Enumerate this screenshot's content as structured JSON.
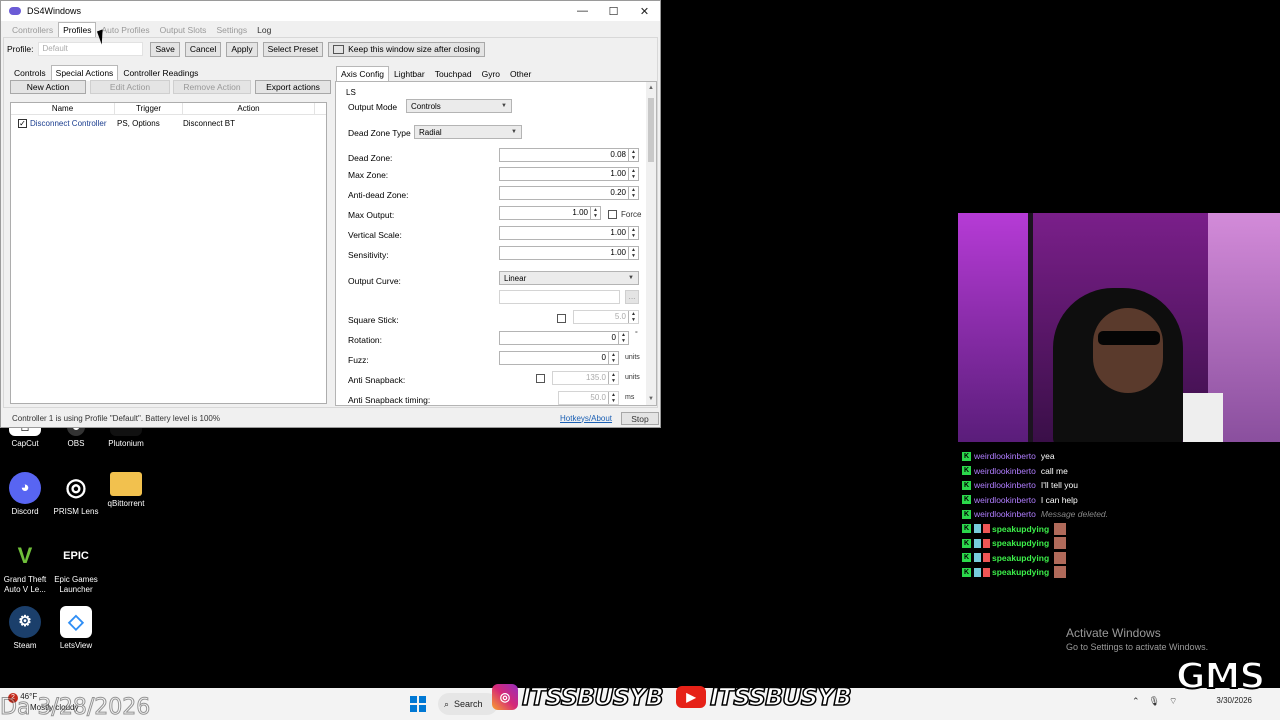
{
  "window": {
    "title": "DS4Windows",
    "controls": [
      "—",
      "☐",
      "✕"
    ]
  },
  "main_tabs": [
    "Controllers",
    "Profiles",
    "Auto Profiles",
    "Output Slots",
    "Settings",
    "Log"
  ],
  "profile_bar": {
    "label": "Profile:",
    "placeholder": "Default",
    "save": "Save",
    "cancel": "Cancel",
    "apply": "Apply",
    "select_preset": "Select Preset",
    "keep_window": "Keep this window size after closing"
  },
  "sub_tabs": [
    "Controls",
    "Special Actions",
    "Controller Readings"
  ],
  "action_buttons": {
    "new": "New Action",
    "edit": "Edit Action",
    "remove": "Remove Action",
    "export": "Export actions"
  },
  "action_list": {
    "columns": [
      "Name",
      "Trigger",
      "Action"
    ],
    "rows": [
      {
        "name": "Disconnect Controller",
        "trigger": "PS, Options",
        "action": "Disconnect BT",
        "checked": true
      }
    ]
  },
  "right_tabs": [
    "Axis Config",
    "Lightbar",
    "Touchpad",
    "Gyro",
    "Other"
  ],
  "axis": {
    "group": "LS",
    "output_mode_label": "Output Mode",
    "output_mode": "Controls",
    "dead_zone_type_label": "Dead Zone Type",
    "dead_zone_type": "Radial",
    "dead_zone_label": "Dead Zone:",
    "dead_zone": "0.08",
    "max_zone_label": "Max Zone:",
    "max_zone": "1.00",
    "anti_dead_label": "Anti-dead Zone:",
    "anti_dead": "0.20",
    "max_output_label": "Max Output:",
    "max_output": "1.00",
    "force_label": "Force",
    "vertical_scale_label": "Vertical Scale:",
    "vertical_scale": "1.00",
    "sensitivity_label": "Sensitivity:",
    "sensitivity": "1.00",
    "output_curve_label": "Output Curve:",
    "output_curve": "Linear",
    "square_stick_label": "Square Stick:",
    "square_stick": "5.0",
    "rotation_label": "Rotation:",
    "rotation": "0",
    "rotation_unit": "°",
    "fuzz_label": "Fuzz:",
    "fuzz": "0",
    "fuzz_unit": "units",
    "anti_snap_label": "Anti Snapback:",
    "anti_snap": "135.0",
    "anti_snap_unit": "units",
    "anti_snap_timing_label": "Anti Snapback timing:",
    "anti_snap_timing": "50.0",
    "anti_snap_timing_unit": "ms",
    "ellipsis": "..."
  },
  "status": {
    "text": "Controller 1 is using Profile \"Default\". Battery level is 100%",
    "hotkeys": "Hotkeys/About",
    "stop": "Stop"
  },
  "desktop_icons": [
    {
      "label": "CapCut",
      "icon": "capcut-icon"
    },
    {
      "label": "OBS",
      "icon": "obs-icon"
    },
    {
      "label": "Plutonium",
      "icon": "plutonium-icon"
    },
    {
      "label": "Discord",
      "icon": "discord-icon",
      "color": "#5865f2"
    },
    {
      "label": "PRISM Lens",
      "icon": "prism-icon"
    },
    {
      "label": "qBittorrent",
      "icon": "folder-icon",
      "color": "#f2c14e"
    },
    {
      "label": "Grand Theft Auto V Le...",
      "icon": "gta-icon"
    },
    {
      "label": "Epic Games Launcher",
      "icon": "epic-icon"
    },
    {
      "label": "Steam",
      "icon": "steam-icon",
      "color": "#1b3f6b"
    },
    {
      "label": "LetsView",
      "icon": "letsview-icon",
      "color": "#2f8ef5"
    }
  ],
  "chat": [
    {
      "user": "weirdlookinberto",
      "msg": "yea"
    },
    {
      "user": "weirdlookinberto",
      "msg": "call me"
    },
    {
      "user": "weirdlookinberto",
      "msg": "I'll tell you"
    },
    {
      "user": "weirdlookinberto",
      "msg": "I can help"
    },
    {
      "user": "weirdlookinberto",
      "msg": "Message deleted."
    },
    {
      "user": "speakupdying",
      "msg": ""
    },
    {
      "user": "speakupdying",
      "msg": ""
    },
    {
      "user": "speakupdying",
      "msg": ""
    },
    {
      "user": "speakupdying",
      "msg": ""
    }
  ],
  "activate": {
    "title": "Activate Windows",
    "sub": "Go to Settings to activate Windows."
  },
  "overlay": {
    "gms": "GMS",
    "date": "Da   3/28/2026"
  },
  "taskbar": {
    "weather_badge": "2",
    "temp": "46°F",
    "weather_desc": "Mostly cloudy",
    "search": "Search",
    "instagram_handle": "ITSSBUSYB",
    "youtube_handle": "ITSSBUSYB",
    "clock_date": "3/30/2026"
  }
}
